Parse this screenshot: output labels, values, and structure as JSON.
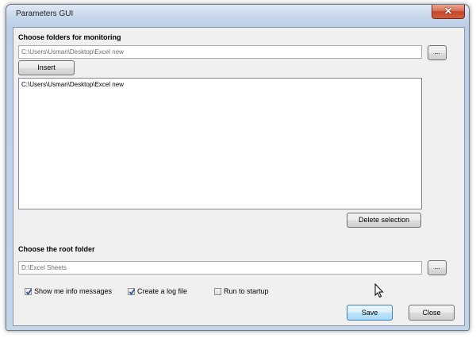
{
  "window": {
    "title": "Parameters GUI",
    "close_glyph": "✕"
  },
  "monitoring": {
    "heading": "Choose folders for monitoring",
    "path_value": "C:\\Users\\Usman\\Desktop\\Excel new",
    "browse_label": "...",
    "insert_label": "Insert",
    "list_items": [
      "C:\\Users\\Usman\\Desktop\\Excel new"
    ],
    "delete_label": "Delete selection"
  },
  "root": {
    "heading": "Choose the root folder",
    "path_value": "D:\\Excel Sheets",
    "browse_label": "..."
  },
  "options": [
    {
      "label": "Show me info messages",
      "checked": true
    },
    {
      "label": "Create a log file",
      "checked": true
    },
    {
      "label": "Run to startup",
      "checked": false
    }
  ],
  "actions": {
    "save_label": "Save",
    "close_label": "Close"
  },
  "colors": {
    "accent": "#3c7fb1",
    "close_button": "#c3452c",
    "checkmark": "#2c4f88"
  }
}
